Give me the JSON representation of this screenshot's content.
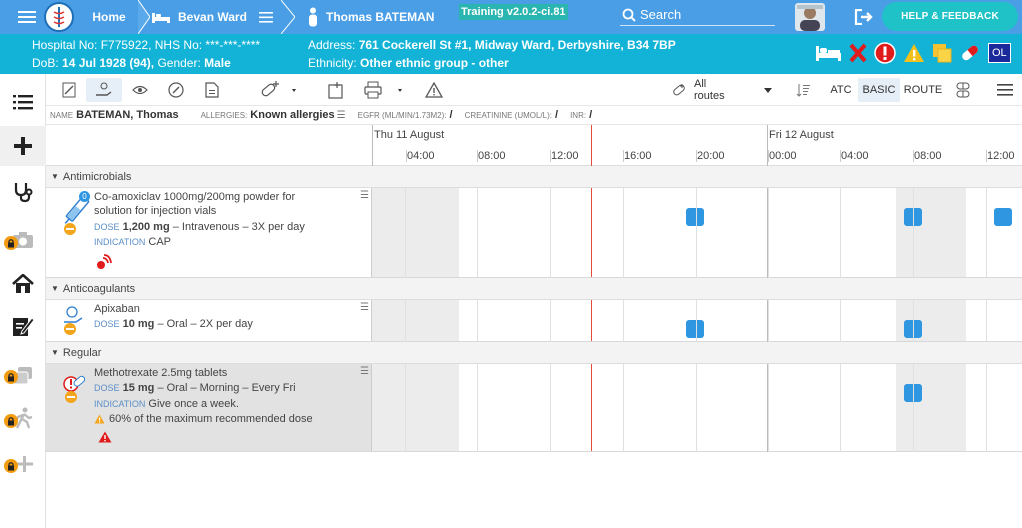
{
  "topbar": {
    "home_label": "Home",
    "ward_label": "Bevan Ward",
    "patient_label": "Thomas BATEMAN",
    "version_badge": "Training v2.0.2-ci.81",
    "search_label": "Search",
    "help_label": "HELP & FEEDBACK"
  },
  "patient": {
    "hospital_line": "Hospital No: F775922, NHS No: ***-***-****",
    "dob_prefix": "DoB:",
    "dob_value": "14 Jul 1928 (94),",
    "gender_prefix": "Gender:",
    "gender_value": "Male",
    "address_prefix": "Address:",
    "address_value": "761 Cockerell St #1, Midway Ward, Derbyshire, B34 7BP",
    "ethnicity_prefix": "Ethnicity:",
    "ethnicity_value": "Other ethnic group - other",
    "ol_badge": "OL"
  },
  "toolbar": {
    "routes_label": "All routes",
    "atc_label": "ATC",
    "basic_label": "BASIC",
    "route_label": "ROUTE"
  },
  "namebar": {
    "name_key": "NAME",
    "name_value": "BATEMAN, Thomas",
    "allergies_key": "ALLERGIES:",
    "allergies_value": "Known allergies",
    "egfr_key": "EGFR (ML/MIN/1.73M2):",
    "egfr_value": "/",
    "creatinine_key": "CREATININE (UMOL/L):",
    "creatinine_value": "/",
    "inr_key": "INR:",
    "inr_value": "/"
  },
  "timeline": {
    "day1": "Thu 11 August",
    "day2": "Fri 12 August",
    "hours": [
      "04:00",
      "08:00",
      "12:00",
      "16:00",
      "20:00",
      "00:00",
      "04:00",
      "08:00",
      "12:00"
    ]
  },
  "sections": {
    "antimicrobials": "Antimicrobials",
    "anticoagulants": "Anticoagulants",
    "regular": "Regular"
  },
  "drugs": {
    "coamox": {
      "name_line1": "Co-amoxiclav 1000mg/200mg powder for",
      "name_line2": "solution for injection vials",
      "dose_key": "DOSE",
      "dose_value": "1,200 mg",
      "dose_rest": "– Intravenous – 3X per day",
      "ind_key": "INDICATION",
      "ind_value": "CAP",
      "badge": "0"
    },
    "apixaban": {
      "name": "Apixaban",
      "dose_key": "DOSE",
      "dose_value": "10 mg",
      "dose_rest": "– Oral – 2X per day"
    },
    "methotrexate": {
      "name": "Methotrexate 2.5mg tablets",
      "dose_key": "DOSE",
      "dose_value": "15 mg",
      "dose_rest": "– Oral – Morning – Every Fri",
      "ind_key": "INDICATION",
      "ind_value": "Give once a week.",
      "warning": "60% of the maximum recommended dose"
    }
  },
  "colors": {
    "topbar": "#4a9ee6",
    "patientbar": "#12b3d6",
    "dose_dot": "#2f96e2",
    "now_line": "#e24a3b"
  }
}
